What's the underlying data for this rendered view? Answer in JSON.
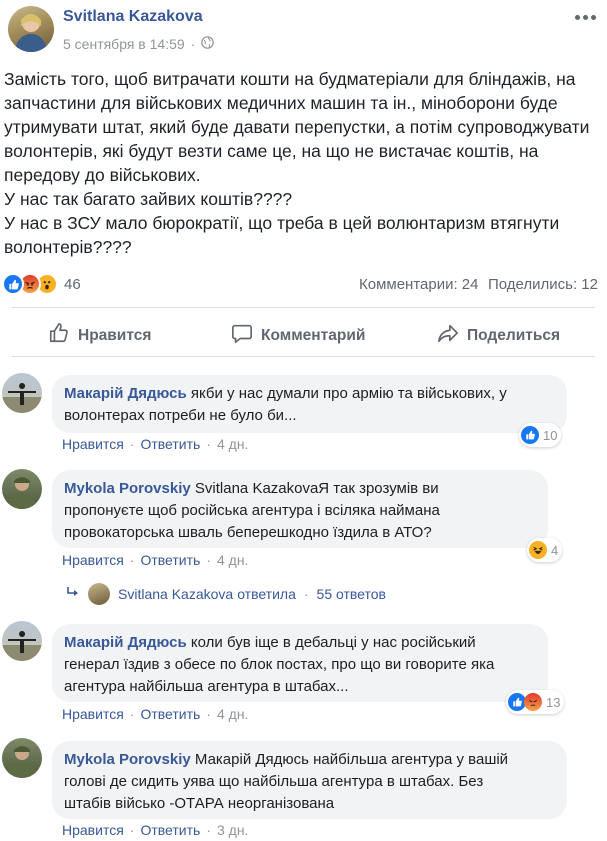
{
  "post": {
    "author": "Svitlana Kazakova",
    "timestamp": "5 сентября в 14:59",
    "separator": "·",
    "privacy_icon": "globe-icon",
    "more_icon": "more-icon",
    "text_lines": [
      "Замість того, щоб витрачати кошти на будматеріали для бліндажів, на",
      "запчастини для військових медичних машин та ін., міноборони буде",
      "утримувати штат, який буде давати перепустки, а потім супроводжувати",
      "волонтерів, які будут везти саме це, на що не вистачає коштів, на",
      "передову до військових.",
      "У нас так багато зайвих коштів????",
      "У нас в ЗСУ мало бюрократії, що треба в цей волюнтаризм втягнути",
      "волонтерів????"
    ],
    "reactions_count": "46",
    "comments_count": "Комментарии: 24",
    "shares_count": "Поделились: 12",
    "colors": {
      "like": "#1877f2",
      "angry": "#e9710f",
      "wow": "#f7b125",
      "link": "#385898"
    }
  },
  "actions": {
    "like": "Нравится",
    "comment": "Комментарий",
    "share": "Поделиться"
  },
  "comments": [
    {
      "author": "Макарій Дядюсь",
      "lines": [
        "якби у нас думали про армію та військових, у",
        "волонтерах потреби не було би..."
      ],
      "like": "Нравится",
      "reply": "Ответить",
      "time": "4 дн.",
      "reactions": "10"
    },
    {
      "author": "Mykola Porovskiy",
      "lines": [
        "Svitlana KazakovaЯ так зрозумів ви",
        "пропонуєте щоб російська агентура і всіляка наймана",
        "провокаторська шваль беперешкодно їздила в АТО?"
      ],
      "like": "Нравится",
      "reply": "Ответить",
      "time": "4 дн.",
      "reactions": "4"
    },
    {
      "author": "Макарій Дядюсь",
      "lines": [
        "коли був іще в дебальці у нас російський",
        "генерал їздив з обесе по блок постах, про що ви говорите яка",
        "агентура найбільша агентура в штабах..."
      ],
      "like": "Нравится",
      "reply": "Ответить",
      "time": "4 дн.",
      "reactions": "13"
    },
    {
      "author": "Mykola Porovskiy",
      "lines": [
        "Макарій Дядюсь найбільша агентура у вашій",
        "голові де сидить уява що найбільша агентура в штабах. Без",
        "штабів військо -ОТАРА неорганізована"
      ],
      "like": "Нравится",
      "reply": "Ответить",
      "time": "3 дн."
    }
  ],
  "reply_summary": {
    "author": "Svitlana Kazakova",
    "action": "ответила",
    "separator": "·",
    "count": "55 ответов"
  }
}
